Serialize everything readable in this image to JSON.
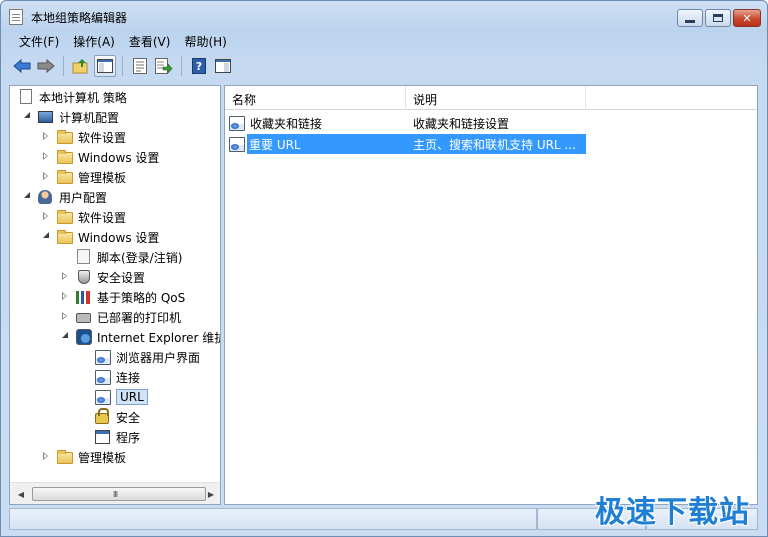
{
  "window": {
    "title": "本地组策略编辑器"
  },
  "menu": [
    "文件(F)",
    "操作(A)",
    "查看(V)",
    "帮助(H)"
  ],
  "tree": {
    "items": [
      {
        "label": "本地计算机 策略"
      },
      {
        "label": "计算机配置"
      },
      {
        "label": "软件设置"
      },
      {
        "label": "Windows 设置"
      },
      {
        "label": "管理模板"
      },
      {
        "label": "用户配置"
      },
      {
        "label": "软件设置"
      },
      {
        "label": "Windows 设置"
      },
      {
        "label": "脚本(登录/注销)"
      },
      {
        "label": "安全设置"
      },
      {
        "label": "基于策略的 QoS"
      },
      {
        "label": "已部署的打印机"
      },
      {
        "label": "Internet Explorer 维护"
      },
      {
        "label": "浏览器用户界面"
      },
      {
        "label": "连接"
      },
      {
        "label": "URL"
      },
      {
        "label": "安全"
      },
      {
        "label": "程序"
      },
      {
        "label": "管理模板"
      }
    ],
    "scroll_grip": "III"
  },
  "list": {
    "columns": [
      "名称",
      "说明"
    ],
    "rows": [
      {
        "name": "收藏夹和链接",
        "desc": "收藏夹和链接设置"
      },
      {
        "name": "重要 URL",
        "desc": "主页、搜索和联机支持 URL ..."
      }
    ]
  },
  "watermark": "极速下载站",
  "colors": {
    "selection": "#3399ff",
    "accent": "#1e7fd4"
  }
}
